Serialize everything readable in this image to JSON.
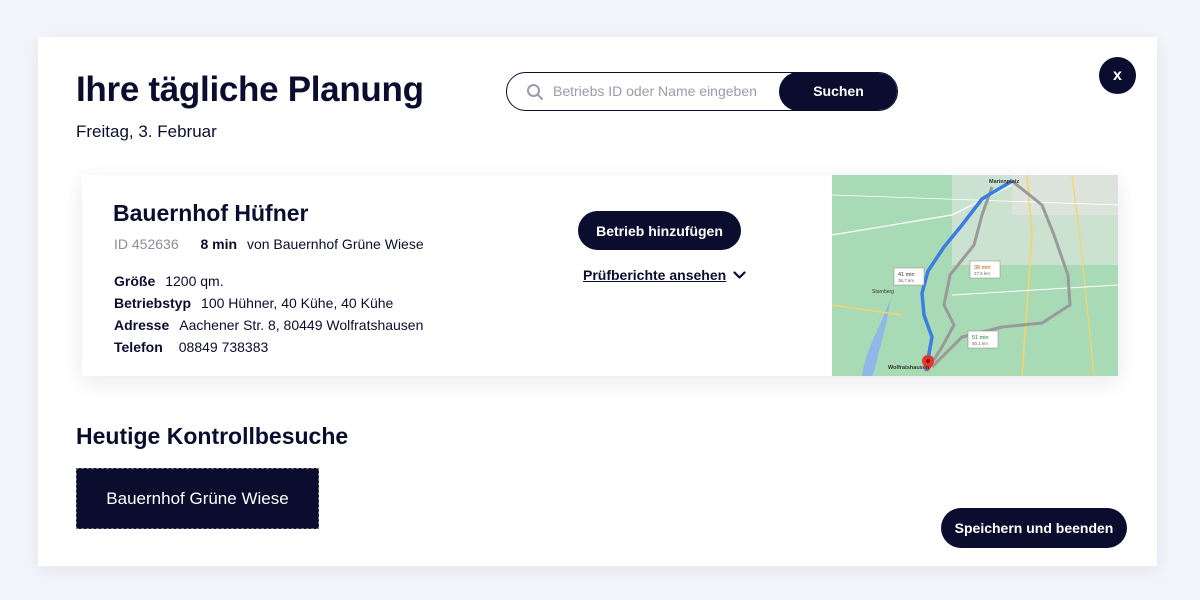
{
  "header": {
    "title": "Ihre tägliche Planung",
    "date": "Freitag, 3. Februar",
    "close_label": "x"
  },
  "search": {
    "placeholder": "Betriebs ID oder Name eingeben",
    "value": "",
    "button_label": "Suchen",
    "icon": "search-icon"
  },
  "farm": {
    "name": "Bauernhof Hüfner",
    "id": "ID 452636",
    "travel_time": "8 min",
    "travel_from": "von Bauernhof Grüne Wiese",
    "details": {
      "size_label": "Größe",
      "size_value": "1200 qm.",
      "type_label": "Betriebstyp",
      "type_value": "100 Hühner, 40 Kühe, 40 Kühe",
      "address_label": "Adresse",
      "address_value": "Aachener Str. 8, 80449 Wolfratshausen",
      "phone_label": "Telefon",
      "phone_value": "08849 738383"
    },
    "add_button_label": "Betrieb hinzufügen",
    "reports_link_label": "Prüfberichte ansehen"
  },
  "visits": {
    "title": "Heutige Kontrollbesuche",
    "items": [
      "Bauernhof Grüne Wiese"
    ]
  },
  "footer": {
    "save_label": "Speichern und beenden"
  },
  "map": {
    "labels": {
      "top": "Marienplatz",
      "bottom": "Wolfratshausen",
      "left": "Starnberg",
      "route_1_time": "41 min",
      "route_1_dist": "36,7 km",
      "route_2_time": "38 min",
      "route_2_dist": "37,5 km",
      "route_3_time": "51 min",
      "route_3_dist": "50,1 km"
    },
    "colors": {
      "land": "#a8dab5",
      "water": "#8fb8e8",
      "route_primary": "#3b7de3",
      "route_alt": "#9a9a9a",
      "road": "#f7d46b",
      "pin": "#e8352e"
    }
  },
  "colors": {
    "primary": "#0b0d2e",
    "background": "#f4f5fa",
    "muted": "#8b8d99"
  }
}
